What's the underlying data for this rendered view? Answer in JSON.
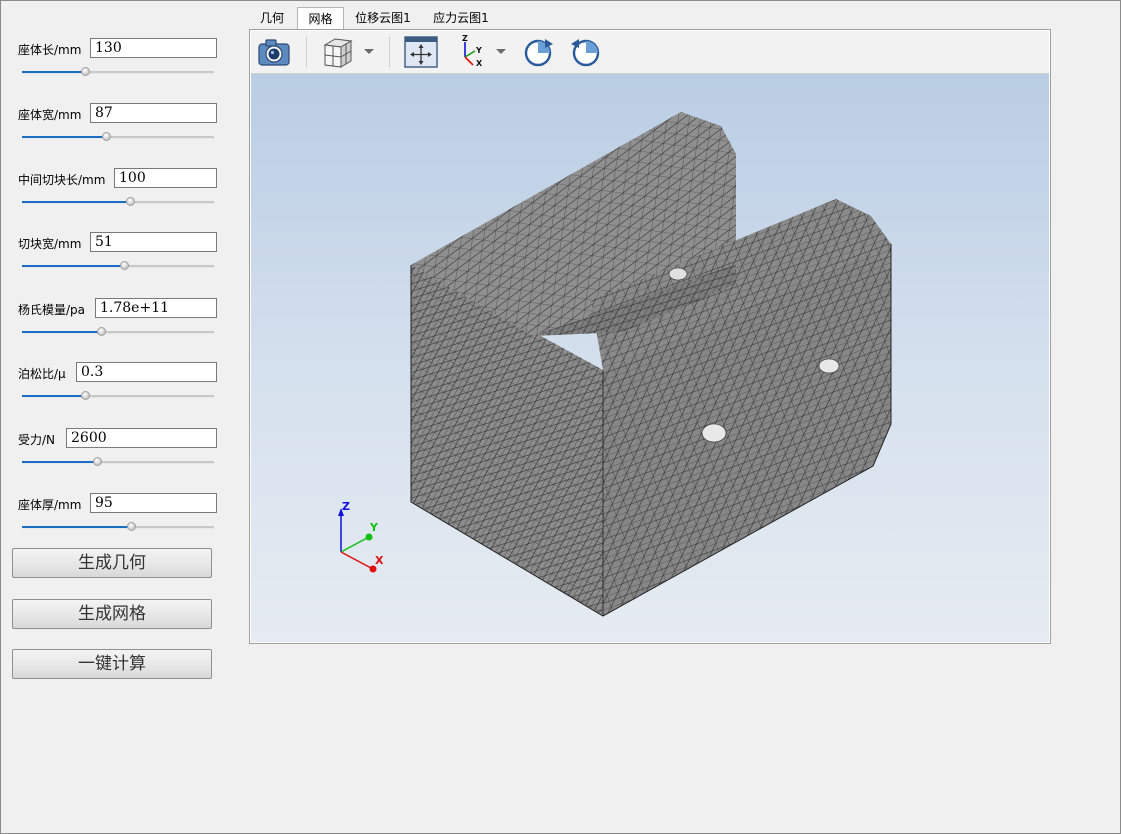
{
  "params": [
    {
      "label": "座体长/mm",
      "value": "130",
      "slider": 0.33
    },
    {
      "label": "座体宽/mm",
      "value": "87",
      "slider": 0.44
    },
    {
      "label": "中间切块长/mm",
      "value": "100",
      "slider": 0.56
    },
    {
      "label": "切块宽/mm",
      "value": "51",
      "slider": 0.53
    },
    {
      "label": "杨氏模量/pa",
      "value": "1.78e+11",
      "slider": 0.41
    },
    {
      "label": "泊松比/μ",
      "value": "0.3",
      "slider": 0.33
    },
    {
      "label": "受力/N",
      "value": "2600",
      "slider": 0.39
    },
    {
      "label": "座体厚/mm",
      "value": "95",
      "slider": 0.57
    }
  ],
  "buttons": {
    "generate_geometry": "生成几何",
    "generate_mesh": "生成网格",
    "one_click_compute": "一键计算"
  },
  "tabs": [
    {
      "label": "几何",
      "active": false
    },
    {
      "label": "网格",
      "active": true
    },
    {
      "label": "位移云图1",
      "active": false
    },
    {
      "label": "应力云图1",
      "active": false
    }
  ],
  "toolbar": {
    "icons": [
      "camera-icon",
      "view-cube-icon",
      "dropdown-arrow-icon",
      "fit-view-icon",
      "axes-icon",
      "dropdown-arrow-icon",
      "rotate-cw-icon",
      "rotate-ccw-icon"
    ]
  },
  "triad": {
    "x": "X",
    "y": "Y",
    "z": "Z"
  },
  "colors": {
    "accent": "#1a6fc4",
    "mesh_fill": "#8a8a8a",
    "mesh_line": "#2b2b2b",
    "axis_x": "#e01010",
    "axis_y": "#10c010",
    "axis_z": "#1010e0"
  }
}
